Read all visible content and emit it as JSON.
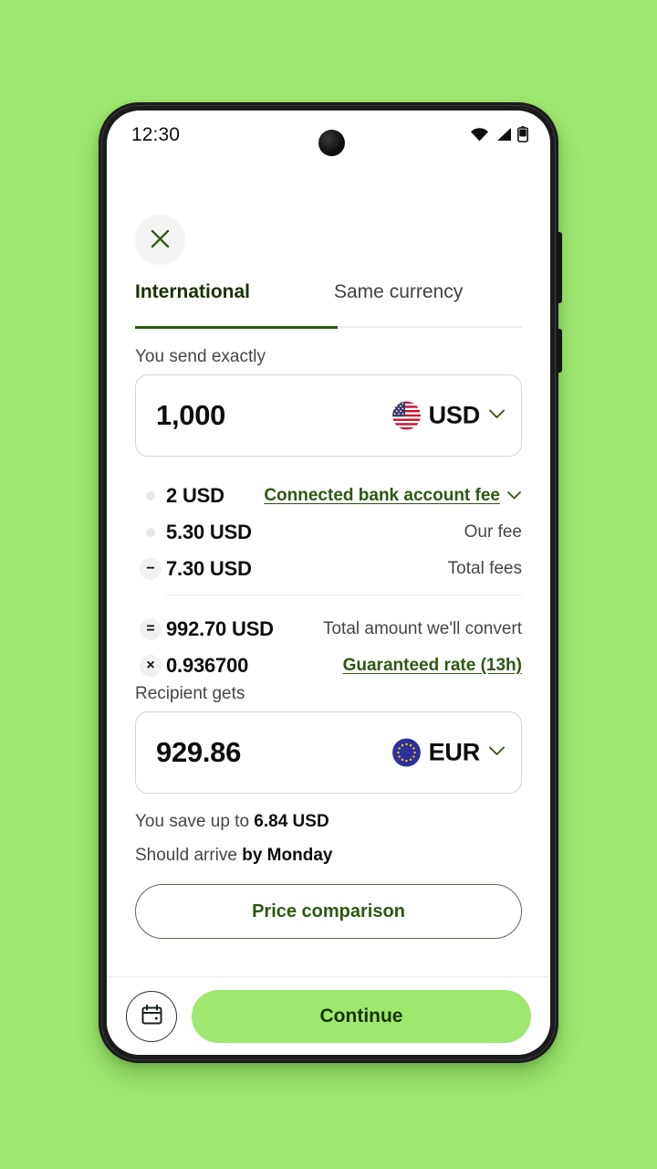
{
  "theme": {
    "background_green": "#9FE870",
    "brand_dark_green": "#163300",
    "link_green": "#2f5711",
    "accent_green": "#9FE870"
  },
  "status_bar": {
    "time": "12:30",
    "icons": [
      "wifi-icon",
      "cellular-signal-icon",
      "battery-icon"
    ]
  },
  "header": {
    "close_icon": "close-icon"
  },
  "tabs": [
    {
      "label": "International",
      "active": true
    },
    {
      "label": "Same currency",
      "active": false
    }
  ],
  "send": {
    "label": "You send exactly",
    "amount": "1,000",
    "currency": "USD",
    "flag": "us-flag-icon",
    "chevron": "chevron-down-icon"
  },
  "fees": {
    "rows": [
      {
        "operator": "",
        "operator_type": "dot",
        "amount": "2 USD",
        "caption": "Connected bank account fee",
        "caption_is_link": true,
        "chevron": "chevron-down-icon"
      },
      {
        "operator": "",
        "operator_type": "dot",
        "amount": "5.30 USD",
        "caption": "Our fee",
        "caption_is_link": false
      },
      {
        "operator": "−",
        "operator_type": "badge",
        "amount": "7.30 USD",
        "caption": "Total fees",
        "caption_is_link": false
      }
    ],
    "totals": [
      {
        "operator": "=",
        "operator_type": "badge",
        "amount": "992.70 USD",
        "caption": "Total amount we'll convert",
        "caption_is_link": false
      },
      {
        "operator": "×",
        "operator_type": "badge",
        "amount": "0.936700",
        "caption": "Guaranteed rate (13h)",
        "caption_is_link": true
      }
    ]
  },
  "recipient": {
    "label": "Recipient gets",
    "amount": "929.86",
    "currency": "EUR",
    "flag": "eu-flag-icon",
    "chevron": "chevron-down-icon"
  },
  "info": {
    "save_prefix": "You save up to ",
    "save_amount": "6.84 USD",
    "arrive_prefix": "Should arrive ",
    "arrive_value": "by Monday"
  },
  "actions": {
    "price_comparison_label": "Price comparison",
    "schedule_icon": "calendar-icon",
    "continue_label": "Continue"
  }
}
